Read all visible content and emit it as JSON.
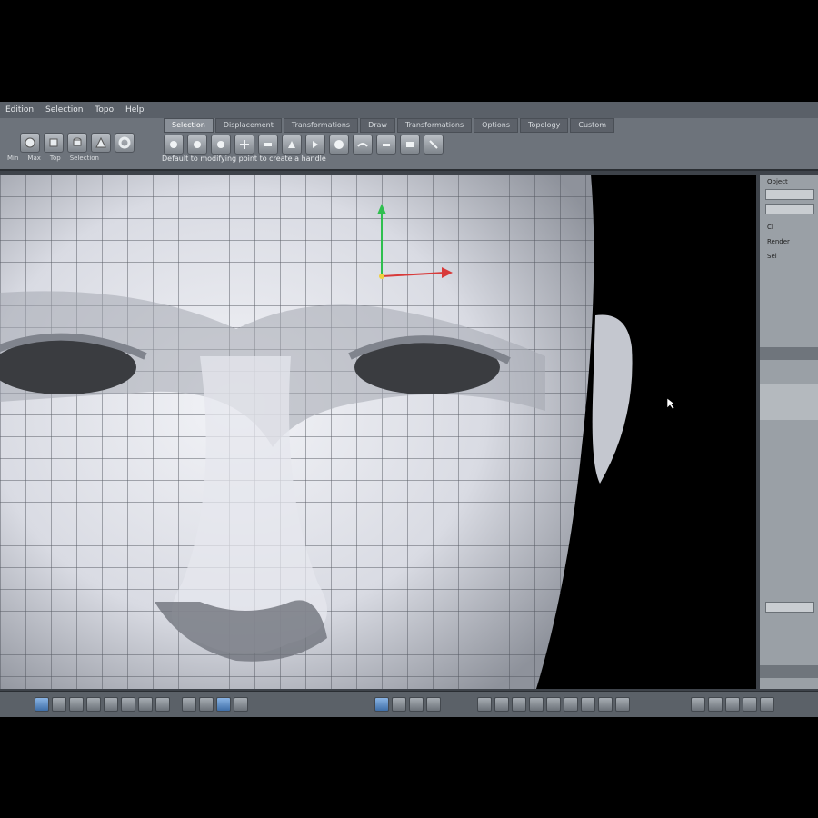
{
  "menubar": {
    "items": [
      "Edition",
      "Selection",
      "Topo",
      "Help"
    ]
  },
  "toolbar": {
    "tabs": [
      {
        "label": "Selection",
        "active": true
      },
      {
        "label": "Displacement",
        "active": false
      },
      {
        "label": "Transformations",
        "active": false
      },
      {
        "label": "Draw",
        "active": false
      },
      {
        "label": "Transformations",
        "active": false
      },
      {
        "label": "Options",
        "active": false
      },
      {
        "label": "Topology",
        "active": false
      },
      {
        "label": "Custom",
        "active": false
      }
    ],
    "hint": "Default to modifying point to create a handle",
    "group_labels": [
      "Min",
      "Max",
      "Top",
      "Selection"
    ]
  },
  "right_panel": {
    "labels": [
      "Object",
      "Cl",
      "Render",
      "Sel"
    ]
  },
  "colors": {
    "accent": "#3f6fa8",
    "panel": "#6d737b",
    "viewport": "#000000"
  }
}
